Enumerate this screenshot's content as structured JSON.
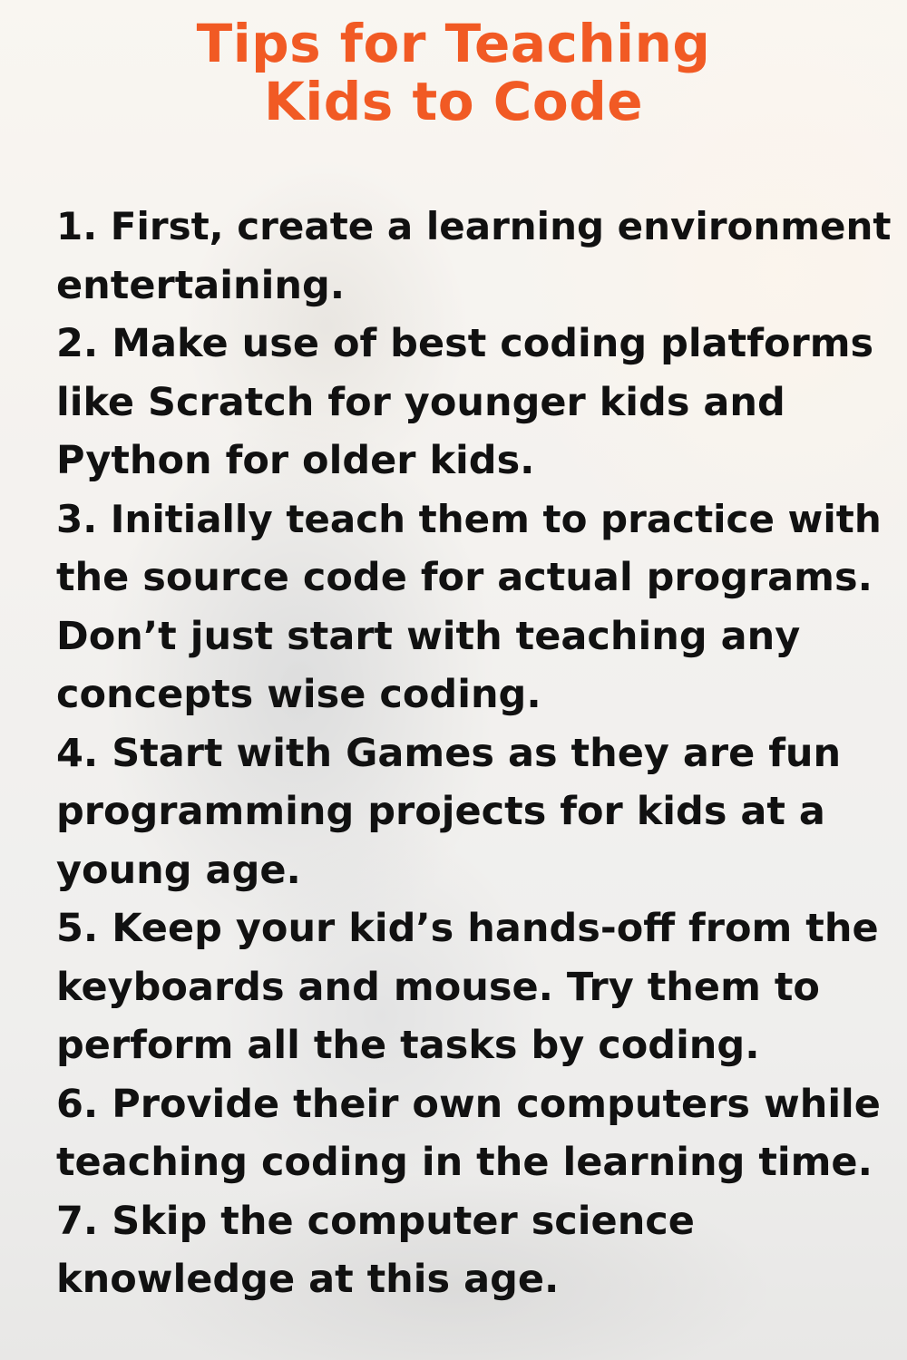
{
  "title": {
    "line1": "Tips for Teaching",
    "line2": "Kids to Code"
  },
  "colors": {
    "title": "#f15a24",
    "text": "#111111"
  },
  "tips": [
    [
      "1. First, create a learning environment",
      "entertaining."
    ],
    [
      "2. Make use of best coding platforms",
      "like Scratch for younger kids and",
      "Python for older kids."
    ],
    [
      "3. Initially teach them to practice with",
      "the source code for actual programs.",
      "Don’t just start with teaching any",
      "concepts wise coding."
    ],
    [
      "4. Start with Games as they are fun",
      "programming projects for kids at a",
      "young age."
    ],
    [
      "5. Keep your kid’s hands-off from the",
      "keyboards and mouse. Try them to",
      "perform all the tasks by coding."
    ],
    [
      "6. Provide their own computers while",
      "teaching coding in the learning time."
    ],
    [
      "7. Skip the computer science",
      "knowledge at this age."
    ]
  ]
}
